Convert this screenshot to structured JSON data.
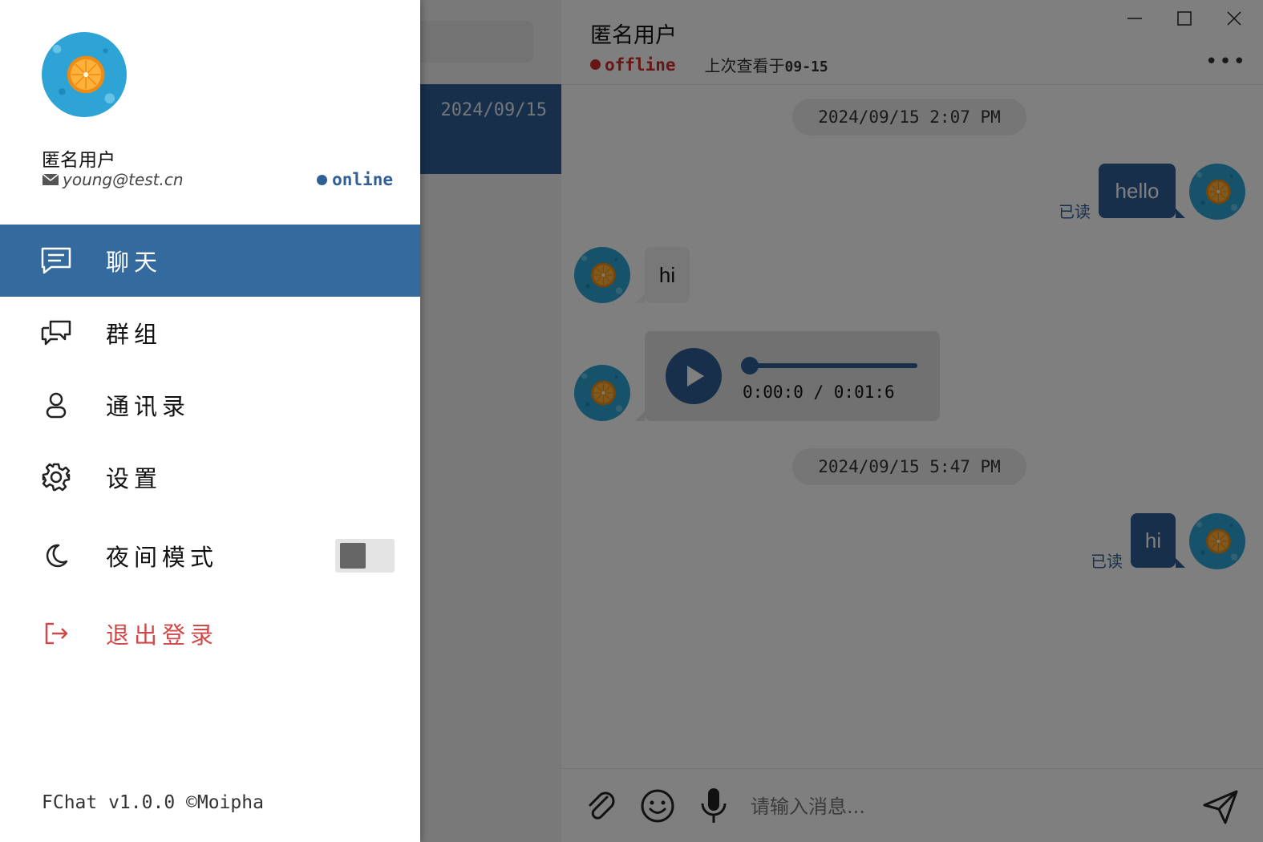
{
  "conversation_list": {
    "selected_item_date": "2024/09/15"
  },
  "chat": {
    "title": "匿名用户",
    "status": "offline",
    "last_seen_prefix": "上次查看于",
    "last_seen_date": "09-15",
    "more_label": "•••",
    "messages": {
      "time_1": "2024/09/15 2:07 PM",
      "msg_1_text": "hello",
      "msg_1_read": "已读",
      "msg_2_text": "hi",
      "audio_time": "0:00:0 / 0:01:6",
      "audio_progress": 0,
      "time_2": "2024/09/15 5:47 PM",
      "msg_3_text": "hi",
      "msg_3_read": "已读"
    },
    "input_placeholder": "请输入消息..."
  },
  "drawer": {
    "user_name": "匿名用户",
    "email": "young@test.cn",
    "status": "online",
    "menu": [
      {
        "label": "聊天",
        "icon": "chat-icon",
        "active": true
      },
      {
        "label": "群组",
        "icon": "group-chat-icon"
      },
      {
        "label": "通讯录",
        "icon": "contacts-icon"
      },
      {
        "label": "设置",
        "icon": "gear-icon"
      },
      {
        "label": "夜间模式",
        "icon": "moon-icon"
      },
      {
        "label": "退出登录",
        "icon": "logout-icon"
      }
    ],
    "night_mode_on": false,
    "footer": "FChat v1.0.0 ©Moipha"
  },
  "colors": {
    "accent": "#2f5f96",
    "active_menu": "#356a9e",
    "offline": "#d02b2b",
    "logout": "#d04848",
    "overlay": "rgba(0,0,0,0.5)"
  }
}
